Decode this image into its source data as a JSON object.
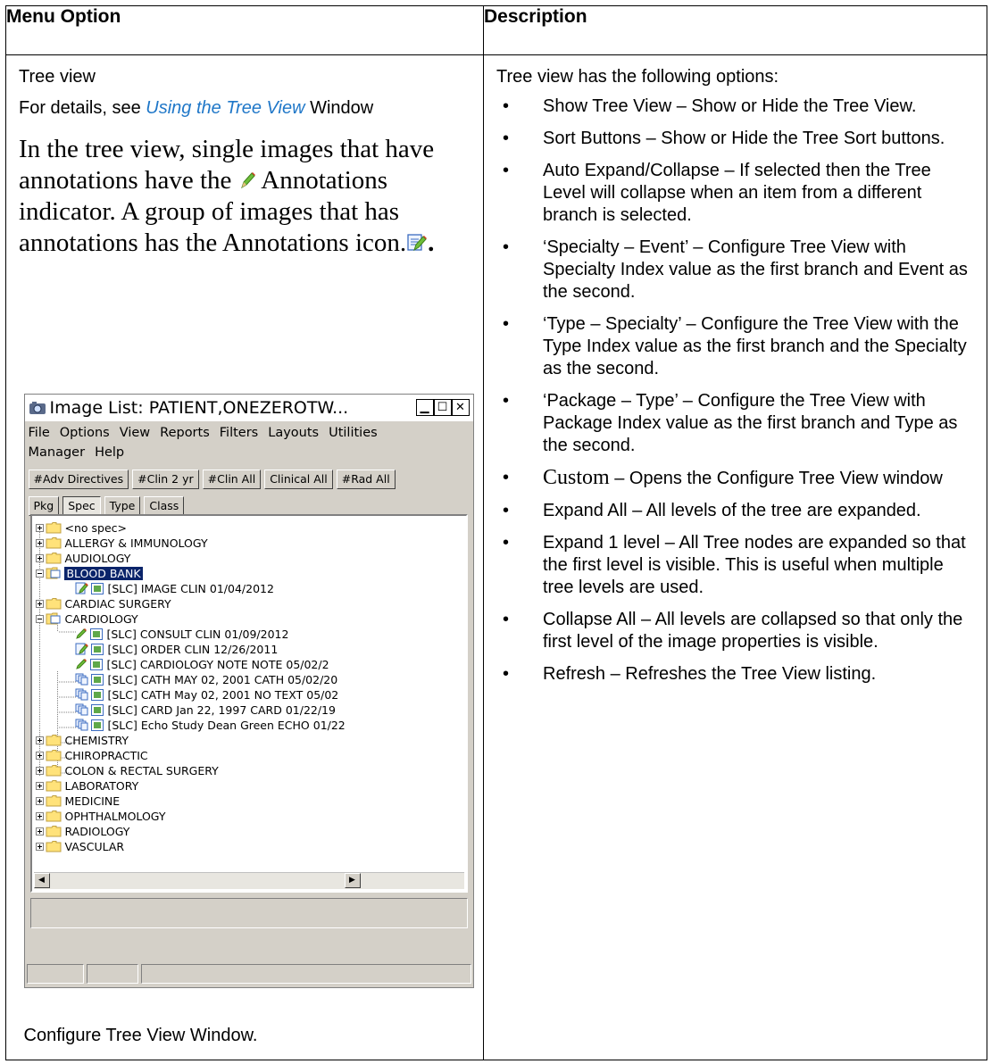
{
  "table": {
    "header_left": "Menu Option",
    "header_right": "Description"
  },
  "left": {
    "title": "Tree view",
    "details_prefix": "For details, see ",
    "details_link": "Using the Tree View",
    "details_suffix": " Window",
    "annot_text_1": "In the tree view, single images that have annotations have the ",
    "annot_text_2": " Annotations indicator. A group of images that has annotations has the Annotations icon.",
    "annot_text_3": ".",
    "caption": "Configure Tree View Window."
  },
  "window": {
    "title": "Image List: PATIENT,ONEZEROTW...",
    "menus": [
      "File",
      "Options",
      "View",
      "Reports",
      "Filters",
      "Layouts",
      "Utilities",
      "Manager",
      "Help"
    ],
    "filter_buttons": [
      "#Adv Directives",
      "#Clin 2 yr",
      "#Clin All",
      "Clinical All",
      "#Rad All"
    ],
    "sort_buttons": [
      "Pkg",
      "Spec",
      "Type",
      "Class"
    ],
    "tree": [
      "<no spec>",
      "ALLERGY & IMMUNOLOGY",
      "AUDIOLOGY",
      "BLOOD BANK",
      "[SLC] IMAGE CLIN 01/04/2012",
      "CARDIAC SURGERY",
      "CARDIOLOGY",
      "[SLC] CONSULT CLIN 01/09/2012",
      "[SLC] ORDER CLIN 12/26/2011",
      "[SLC] CARDIOLOGY NOTE NOTE 05/02/2",
      "[SLC] CATH MAY 02, 2001 CATH 05/02/20",
      "[SLC] CATH  May 02, 2001 NO TEXT 05/02",
      "[SLC] CARD  Jan 22, 1997 CARD 01/22/19",
      "[SLC] Echo Study Dean Green ECHO 01/22",
      "CHEMISTRY",
      "CHIROPRACTIC",
      "COLON & RECTAL SURGERY",
      "LABORATORY",
      "MEDICINE",
      "OPHTHALMOLOGY",
      "RADIOLOGY",
      "VASCULAR"
    ]
  },
  "right": {
    "intro": "Tree view has the following options:",
    "items": [
      "Show Tree View – Show or Hide the Tree View.",
      "Sort Buttons – Show or Hide the Tree Sort buttons.",
      "Auto Expand/Collapse – If selected then the Tree Level will collapse when an item from a different branch is selected.",
      "‘Specialty – Event’ – Configure Tree View with Specialty Index value as the first branch and Event as the second.",
      "‘Type – Specialty’ – Configure the Tree View with the Type Index value as the first branch and the Specialty as the second.",
      "‘Package – Type’ – Configure the Tree View with Package Index value as the first branch and Type as the second.",
      " – Opens the Configure Tree View window",
      "Expand All – All levels of the tree are expanded.",
      "Expand 1 level – All Tree nodes are expanded so that the first level is visible. This is useful when multiple tree levels are used.",
      "Collapse All – All levels are collapsed so that only the first level of the image properties is visible.",
      "Refresh – Refreshes the Tree View listing."
    ],
    "custom_word": "Custom"
  }
}
